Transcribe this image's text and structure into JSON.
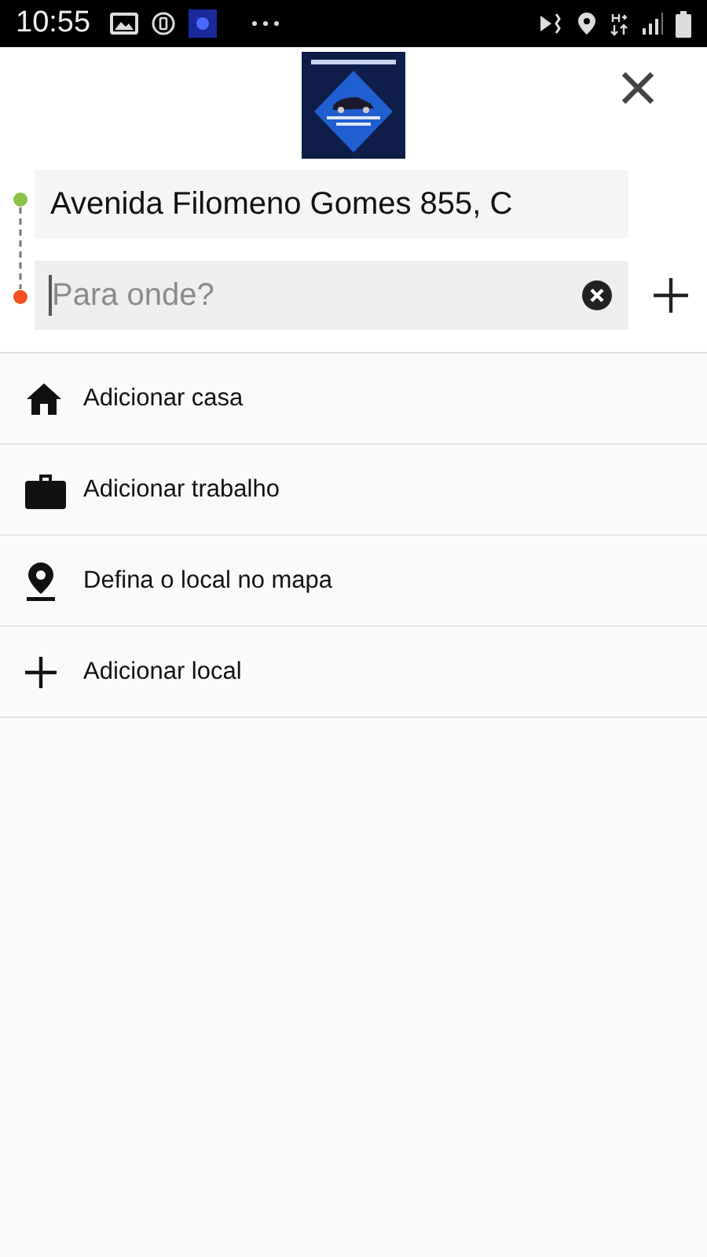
{
  "status_bar": {
    "time": "10:55"
  },
  "route": {
    "origin": {
      "value": "Avenida Filomeno Gomes 855, C"
    },
    "destination": {
      "placeholder": "Para onde?"
    }
  },
  "places": [
    {
      "kind": "home",
      "label": "Adicionar casa"
    },
    {
      "kind": "work",
      "label": "Adicionar trabalho"
    },
    {
      "kind": "pin",
      "label": "Defina o local no mapa"
    },
    {
      "kind": "add",
      "label": "Adicionar local"
    }
  ]
}
